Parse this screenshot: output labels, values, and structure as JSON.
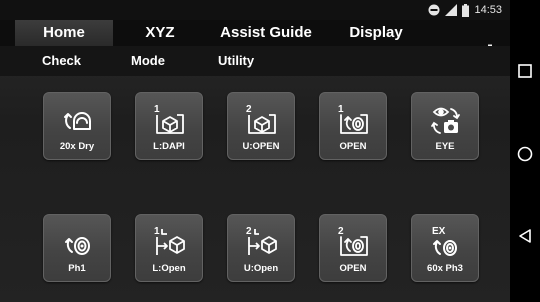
{
  "status": {
    "time": "14:53",
    "icons": [
      "do-not-disturb-icon",
      "signal-icon",
      "battery-icon"
    ]
  },
  "tabs": [
    {
      "label": "Home",
      "active": true
    },
    {
      "label": "XYZ",
      "active": false
    },
    {
      "label": "Assist Guide",
      "active": false
    },
    {
      "label": "Display",
      "active": false
    }
  ],
  "settings_icon": "gear-icon",
  "sub_menu": [
    "Check",
    "Mode",
    "Utility"
  ],
  "buttons": [
    {
      "label": "20x Dry",
      "icon": "dry-objective-icon",
      "badge": ""
    },
    {
      "label": "L:DAPI",
      "icon": "cube-filter-icon",
      "badge": "1"
    },
    {
      "label": "U:OPEN",
      "icon": "cube-filter-icon",
      "badge": "2"
    },
    {
      "label": "OPEN",
      "icon": "turret-open-icon",
      "badge": "1"
    },
    {
      "label": "EYE",
      "icon": "eye-camera-icon",
      "badge": ""
    },
    {
      "label": "Ph1",
      "icon": "phase-objective-icon",
      "badge": ""
    },
    {
      "label": "L:Open",
      "icon": "cube-path-icon",
      "badge": "1"
    },
    {
      "label": "U:Open",
      "icon": "cube-path-icon",
      "badge": "2"
    },
    {
      "label": "OPEN",
      "icon": "turret-open-icon",
      "badge": "2"
    },
    {
      "label": "60x Ph3",
      "icon": "phase-objective-icon",
      "badge": "EX"
    }
  ],
  "nav": [
    "recents-square-icon",
    "home-circle-icon",
    "back-triangle-icon"
  ]
}
